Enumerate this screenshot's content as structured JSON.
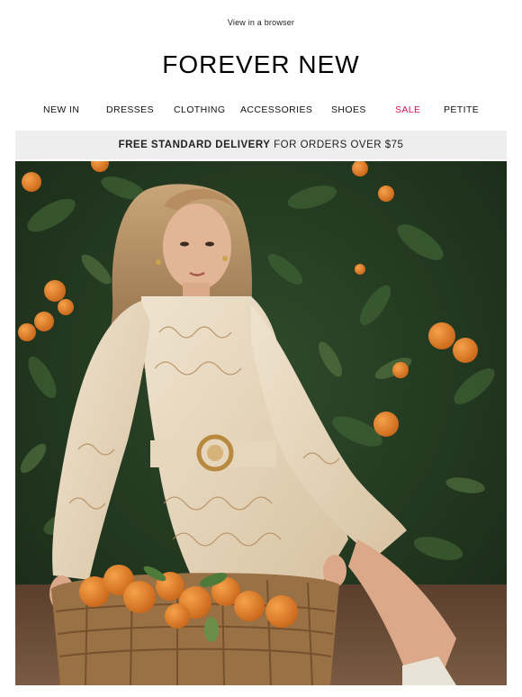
{
  "header": {
    "view_in_browser": "View in a browser",
    "logo": "FOREVER NEW"
  },
  "nav": {
    "items": [
      {
        "label": "NEW IN"
      },
      {
        "label": "DRESSES"
      },
      {
        "label": "CLOTHING"
      },
      {
        "label": "ACCESSORIES"
      },
      {
        "label": "SHOES"
      },
      {
        "label": "SALE"
      },
      {
        "label": "PETITE"
      }
    ]
  },
  "banner": {
    "bold": "FREE STANDARD DELIVERY",
    "rest": "FOR ORDERS OVER $75"
  },
  "colors": {
    "sale": "#d0124d",
    "banner_bg": "#eeeeee"
  }
}
